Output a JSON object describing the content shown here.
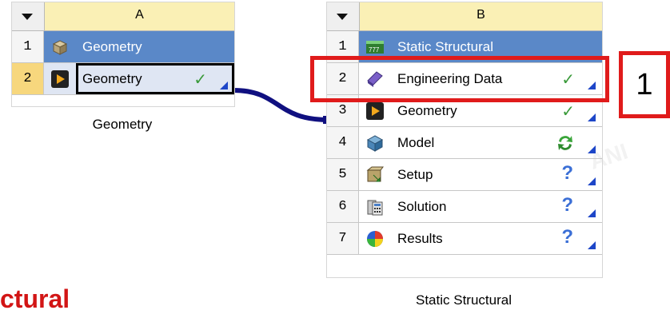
{
  "system_a": {
    "column_letter": "A",
    "rows": [
      {
        "num": "1",
        "label": "Geometry"
      },
      {
        "num": "2",
        "label": "Geometry",
        "status": "✓"
      }
    ],
    "caption": "Geometry"
  },
  "system_b": {
    "column_letter": "B",
    "rows": [
      {
        "num": "1",
        "label": "Static Structural"
      },
      {
        "num": "2",
        "label": "Engineering Data",
        "status": "✓"
      },
      {
        "num": "3",
        "label": "Geometry",
        "status": "✓"
      },
      {
        "num": "4",
        "label": "Model",
        "status": "refresh-icon"
      },
      {
        "num": "5",
        "label": "Setup",
        "status": "?"
      },
      {
        "num": "6",
        "label": "Solution",
        "status": "?"
      },
      {
        "num": "7",
        "label": "Results",
        "status": "?"
      }
    ],
    "caption": "Static Structural"
  },
  "callout": {
    "number": "1"
  },
  "bottom_text": "ctural",
  "watermark": "ANI",
  "colors": {
    "title_row": "#5a88c8",
    "header_col": "#faf0b5",
    "selected_num": "#f7d77d",
    "highlight_red": "#e01b1b",
    "link_line": "#101080",
    "check_green": "#3a9a3a",
    "corner_blue": "#1d46c8"
  }
}
